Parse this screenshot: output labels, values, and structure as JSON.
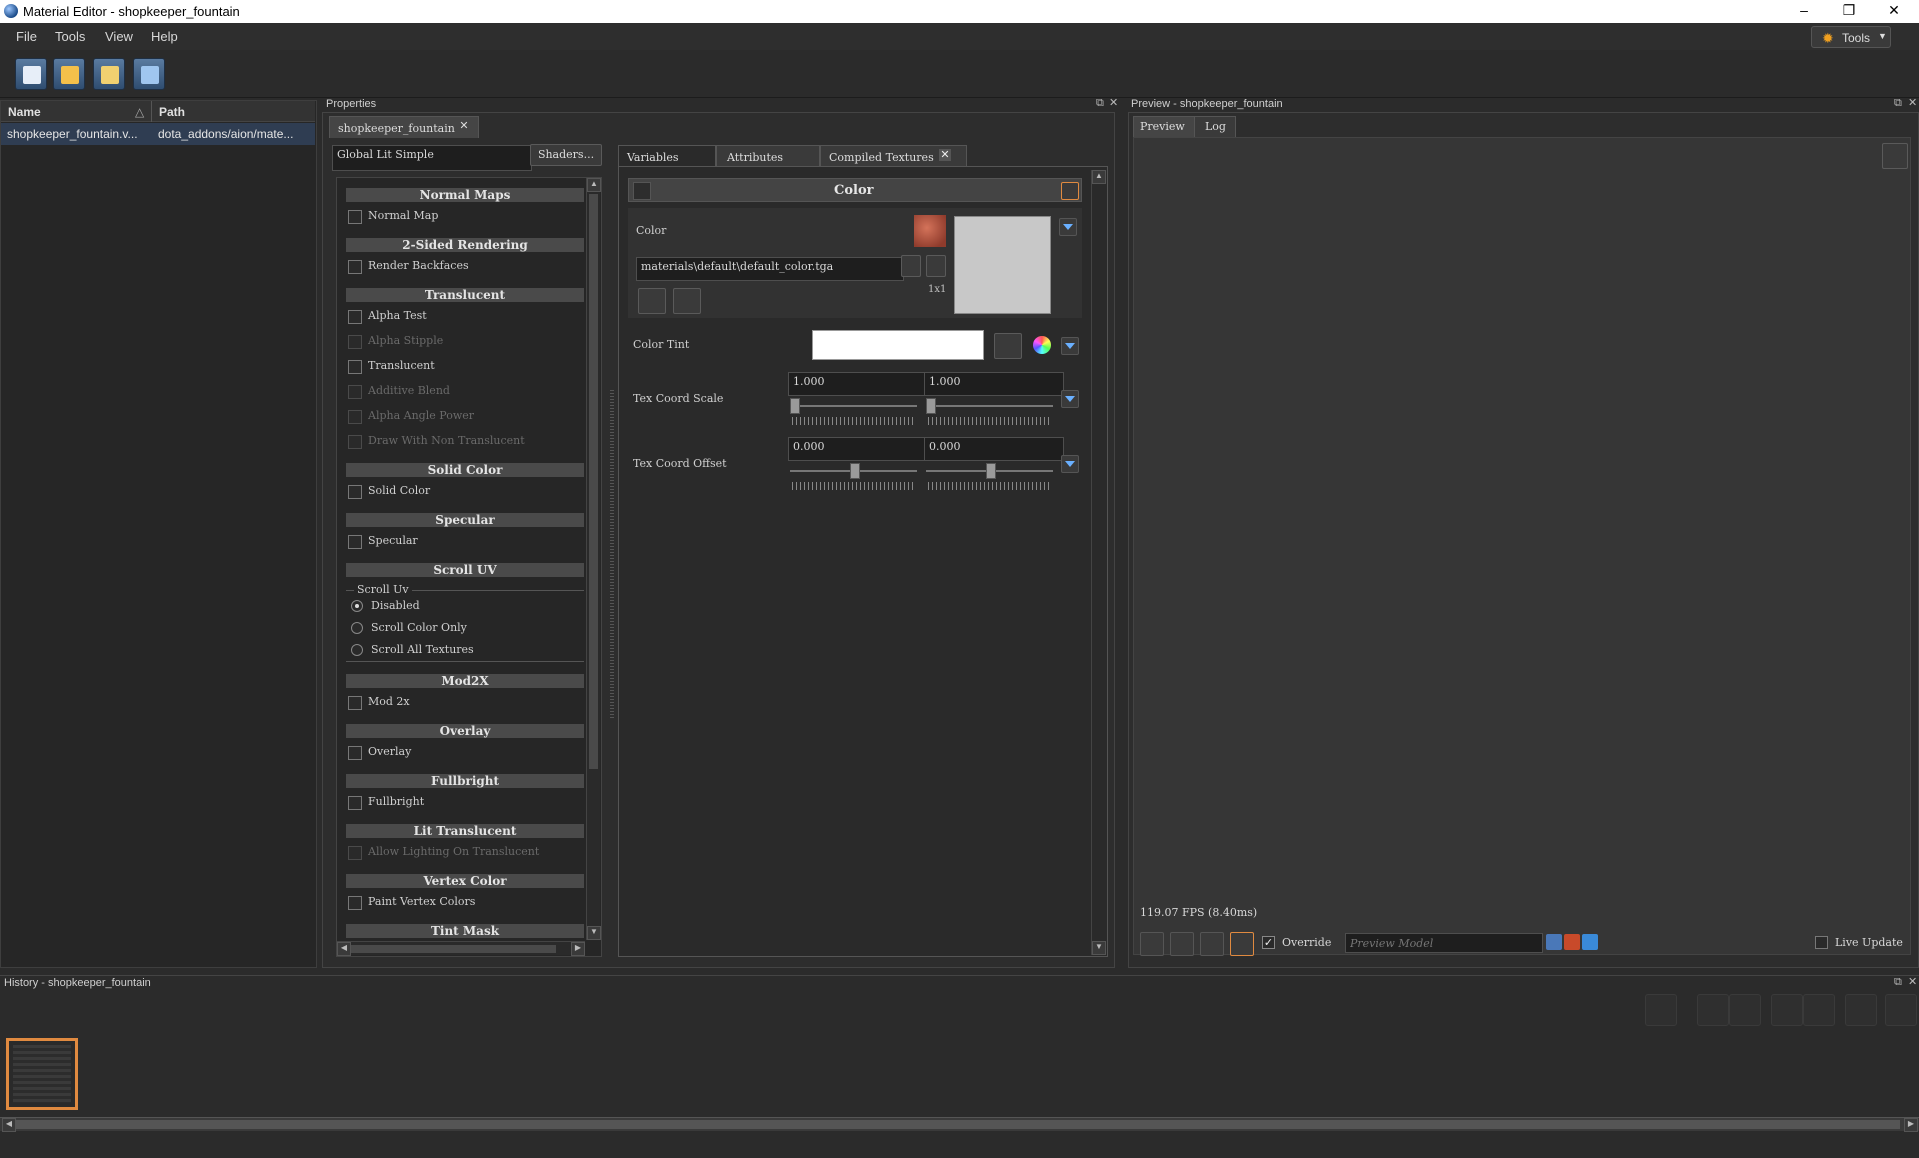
{
  "window": {
    "title": "Material Editor - shopkeeper_fountain",
    "minimize_glyph": "–",
    "restore_glyph": "❐",
    "close_glyph": "✕"
  },
  "menu": {
    "items": [
      "File",
      "Tools",
      "View",
      "Help"
    ],
    "tools_button": "Tools"
  },
  "toolbar": {
    "buttons": [
      "new-material-icon",
      "open-icon",
      "save-icon",
      "save-all-icon"
    ]
  },
  "file_list": {
    "columns": [
      "Name",
      "Path"
    ],
    "sort_glyph": "△",
    "rows": [
      {
        "name": "shopkeeper_fountain.v...",
        "path": "dota_addons/aion/mate..."
      }
    ]
  },
  "properties": {
    "dock_title": "Properties",
    "doc_tab": "shopkeeper_fountain",
    "tab_close": "✕",
    "shader_field": "Global Lit Simple",
    "shaders_button": "Shaders...",
    "sections": [
      {
        "title": "Normal Maps",
        "options": [
          {
            "label": "Normal Map",
            "enabled": true
          }
        ]
      },
      {
        "title": "2-Sided Rendering",
        "options": [
          {
            "label": "Render Backfaces",
            "enabled": true
          }
        ]
      },
      {
        "title": "Translucent",
        "options": [
          {
            "label": "Alpha Test",
            "enabled": true
          },
          {
            "label": "Alpha Stipple",
            "enabled": false
          },
          {
            "label": "Translucent",
            "enabled": true
          },
          {
            "label": "Additive Blend",
            "enabled": false
          },
          {
            "label": "Alpha Angle Power",
            "enabled": false
          },
          {
            "label": "Draw With Non Translucent",
            "enabled": false
          }
        ]
      },
      {
        "title": "Solid Color",
        "options": [
          {
            "label": "Solid Color",
            "enabled": true
          }
        ]
      },
      {
        "title": "Specular",
        "options": [
          {
            "label": "Specular",
            "enabled": true
          }
        ]
      },
      {
        "title": "Scroll UV",
        "group_label": "Scroll Uv",
        "radios": [
          {
            "label": "Disabled",
            "selected": true
          },
          {
            "label": "Scroll Color Only",
            "selected": false
          },
          {
            "label": "Scroll All Textures",
            "selected": false
          }
        ]
      },
      {
        "title": "Mod2X",
        "options": [
          {
            "label": "Mod 2x",
            "enabled": true
          }
        ]
      },
      {
        "title": "Overlay",
        "options": [
          {
            "label": "Overlay",
            "enabled": true
          }
        ]
      },
      {
        "title": "Fullbright",
        "options": [
          {
            "label": "Fullbright",
            "enabled": true
          }
        ]
      },
      {
        "title": "Lit Translucent",
        "options": [
          {
            "label": "Allow Lighting On Translucent",
            "enabled": false
          }
        ]
      },
      {
        "title": "Vertex Color",
        "options": [
          {
            "label": "Paint Vertex Colors",
            "enabled": true
          }
        ]
      },
      {
        "title": "Tint Mask",
        "options": []
      }
    ]
  },
  "variables": {
    "tabs": [
      "Variables",
      "Attributes",
      "Compiled Textures"
    ],
    "active_tab": "Variables",
    "group_title": "Color",
    "color_label": "Color",
    "texture_path": "materials\\default\\default_color.tga",
    "texture_size": "1x1",
    "color_tint_label": "Color Tint",
    "color_tint_value": "#ffffff",
    "tex_coord_scale": {
      "label": "Tex Coord Scale",
      "x": "1.000",
      "y": "1.000",
      "slider_x": 0.0,
      "slider_y": 0.0
    },
    "tex_coord_offset": {
      "label": "Tex Coord Offset",
      "x": "0.000",
      "y": "0.000",
      "slider_x": 0.5,
      "slider_y": 0.5
    }
  },
  "preview": {
    "dock_title": "Preview - shopkeeper_fountain",
    "tabs": [
      "Preview",
      "Log"
    ],
    "fps": "119.07 FPS (8.40ms)",
    "override_label": "Override",
    "override_checked": true,
    "preview_model_placeholder": "Preview Model",
    "live_update_label": "Live Update",
    "live_update_checked": false
  },
  "history": {
    "dock_title": "History - shopkeeper_fountain"
  },
  "colors": {
    "accent_orange": "#e08a40",
    "accent_blue": "#6ab0ff",
    "panel_bg": "#2d2d2d"
  }
}
